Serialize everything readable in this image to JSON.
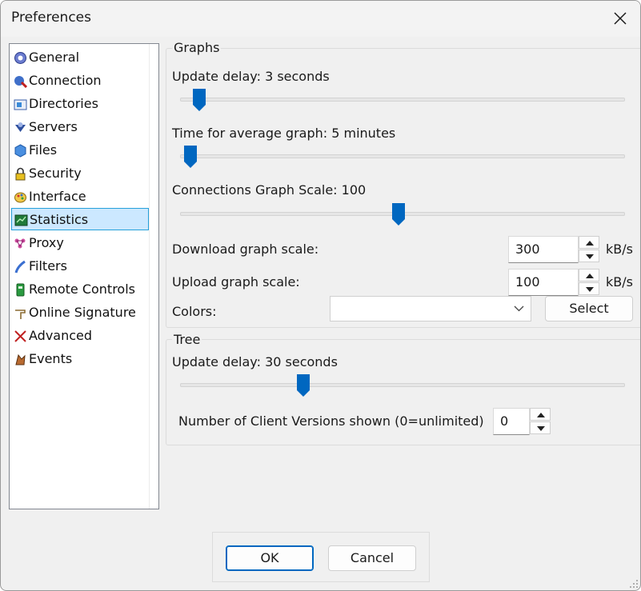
{
  "window": {
    "title": "Preferences"
  },
  "sidebar": {
    "items": [
      {
        "label": "General",
        "icon": "gear-icon"
      },
      {
        "label": "Connection",
        "icon": "connection-icon"
      },
      {
        "label": "Directories",
        "icon": "folder-icon"
      },
      {
        "label": "Servers",
        "icon": "server-icon"
      },
      {
        "label": "Files",
        "icon": "files-icon"
      },
      {
        "label": "Security",
        "icon": "lock-icon"
      },
      {
        "label": "Interface",
        "icon": "palette-icon"
      },
      {
        "label": "Statistics",
        "icon": "statistics-icon",
        "selected": true
      },
      {
        "label": "Proxy",
        "icon": "proxy-icon"
      },
      {
        "label": "Filters",
        "icon": "filter-icon"
      },
      {
        "label": "Remote Controls",
        "icon": "remote-icon"
      },
      {
        "label": "Online Signature",
        "icon": "signature-icon"
      },
      {
        "label": "Advanced",
        "icon": "advanced-icon"
      },
      {
        "label": "Events",
        "icon": "events-icon"
      }
    ]
  },
  "graphs": {
    "title": "Graphs",
    "update_delay_label": "Update delay: 3 seconds",
    "update_delay_fraction": 0.03,
    "avg_graph_label": "Time for average graph: 5 minutes",
    "avg_graph_fraction": 0.01,
    "connections_scale_label": "Connections Graph Scale: 100",
    "connections_scale_fraction": 0.49,
    "download_scale_label": "Download graph scale:",
    "download_scale_value": "300",
    "download_unit": "kB/s",
    "upload_scale_label": "Upload graph scale:",
    "upload_scale_value": "100",
    "upload_unit": "kB/s",
    "colors_label": "Colors:",
    "colors_value": "",
    "select_button": "Select"
  },
  "tree": {
    "title": "Tree",
    "update_delay_label": "Update delay: 30 seconds",
    "update_delay_fraction": 0.27,
    "client_versions_label": "Number of Client Versions shown (0=unlimited)",
    "client_versions_value": "0"
  },
  "footer": {
    "ok": "OK",
    "cancel": "Cancel"
  },
  "colors": {
    "accent": "#0067c0",
    "selection_bg": "#cce8ff",
    "selection_border": "#26a0da"
  }
}
